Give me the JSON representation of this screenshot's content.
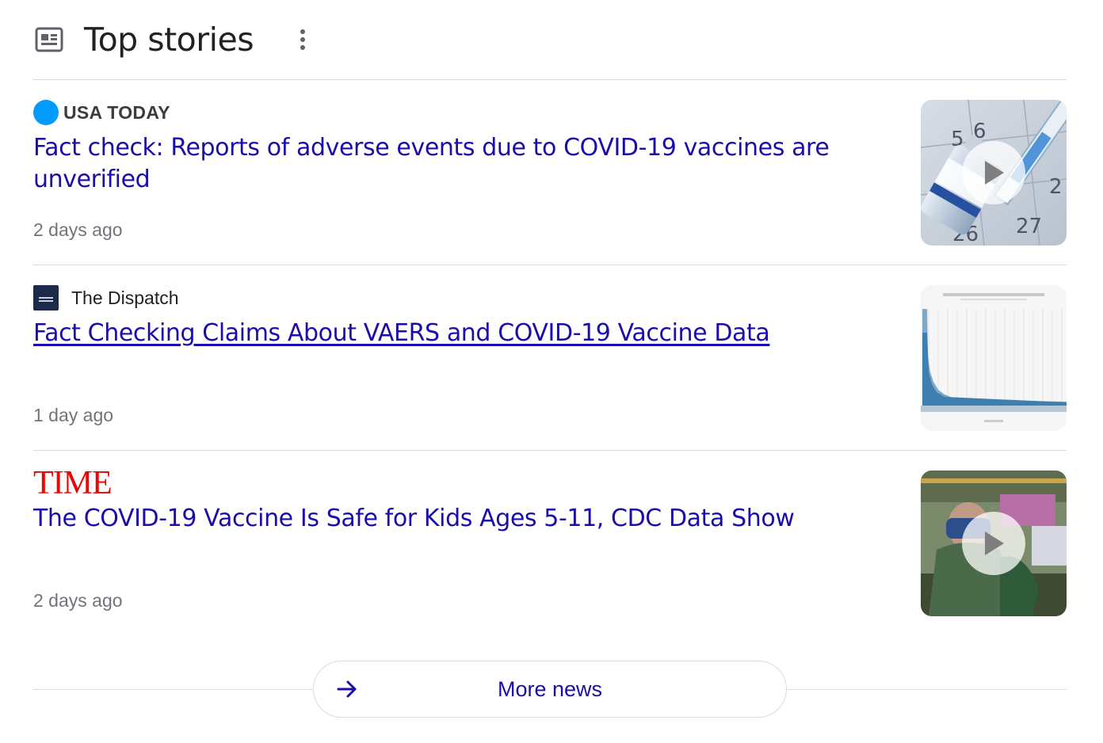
{
  "header": {
    "title": "Top stories",
    "icon": "news-icon",
    "menu_icon": "more-vert-icon"
  },
  "stories": [
    {
      "publisher": "USA TODAY",
      "headline": "Fact check: Reports of adverse events due to COVID-19 vaccines are unverified",
      "time": "2 days ago",
      "thumbnail": "vaccine-vial-syringe-video",
      "has_video": true
    },
    {
      "publisher": "The Dispatch",
      "headline": "Fact Checking Claims About VAERS and COVID-19 Vaccine Data",
      "time": "1 day ago",
      "thumbnail": "bar-chart-image",
      "has_video": false
    },
    {
      "publisher": "TIME",
      "headline": "The COVID-19 Vaccine Is Safe for Kids Ages 5-11, CDC Data Show",
      "time": "2 days ago",
      "thumbnail": "child-classroom-video",
      "has_video": true
    }
  ],
  "more": {
    "label": "More news",
    "icon": "arrow-right-icon"
  },
  "colors": {
    "link": "#1a0dab",
    "meta": "#70757a",
    "divider": "#dadce0",
    "usa_today_blue": "#009bff",
    "time_red": "#e90606"
  }
}
